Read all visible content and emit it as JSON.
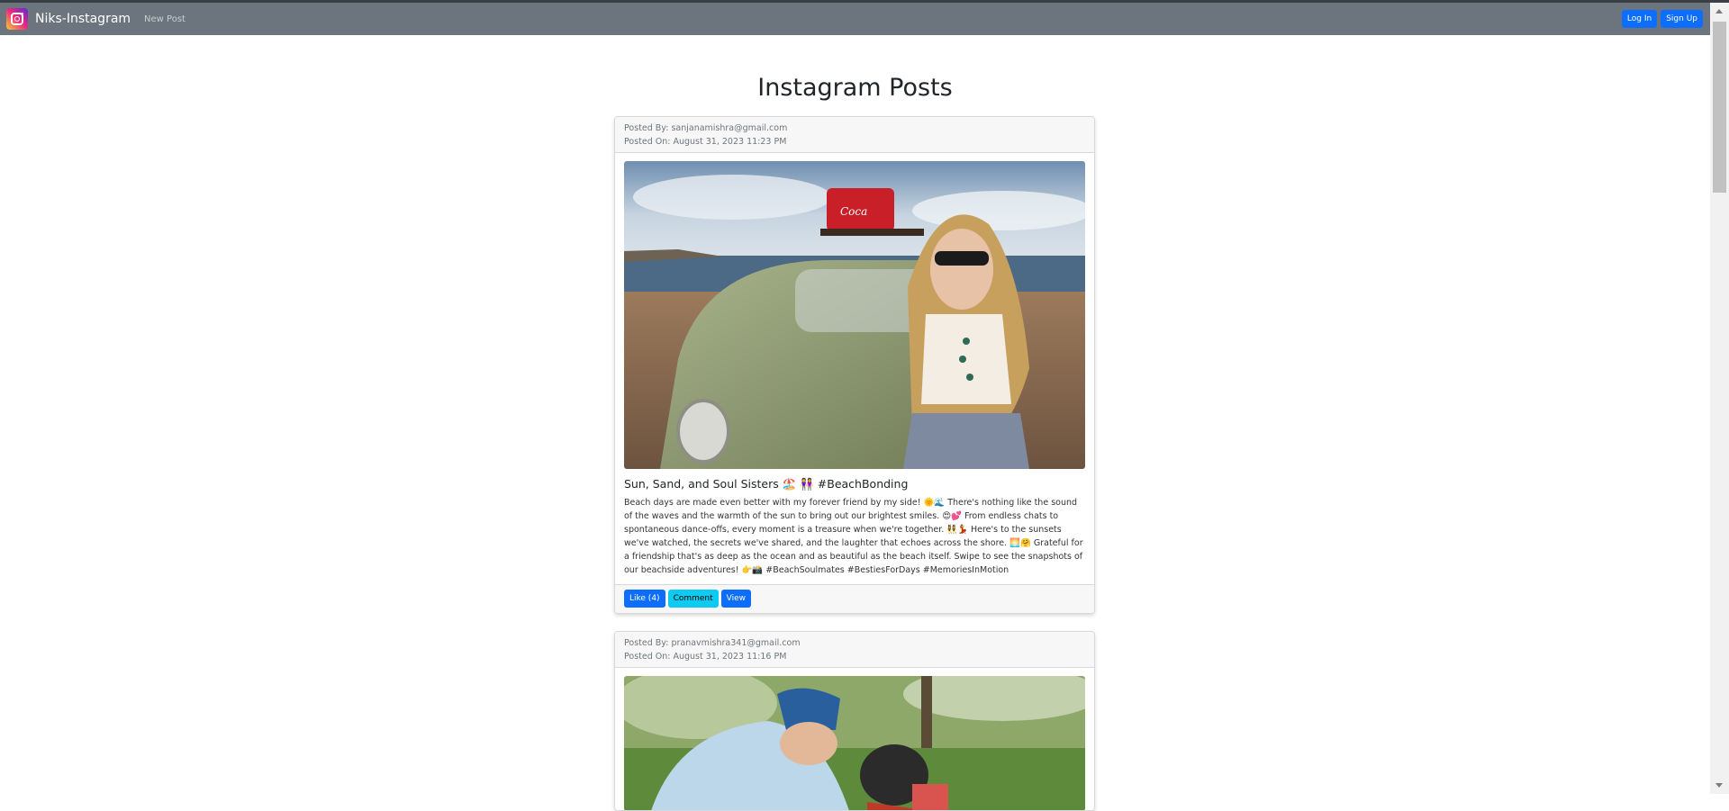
{
  "app": {
    "brand": "Niks-Instagram",
    "nav_new_post": "New Post",
    "login_label": "Log In",
    "signup_label": "Sign Up"
  },
  "page": {
    "title": "Instagram Posts"
  },
  "posts": [
    {
      "posted_by": "Posted By: sanjanamishra@gmail.com",
      "posted_on": "Posted On: August 31, 2023 11:23 PM",
      "title": "Sun, Sand, and Soul Sisters 🏖️ 👭 #BeachBonding",
      "body": "Beach days are made even better with my forever friend by my side! 🌞🌊 There's nothing like the sound of the waves and the warmth of the sun to bring out our brightest smiles. 😍💕 From endless chats to spontaneous dance-offs, every moment is a treasure when we're together. 👯‍♀️💃 Here's to the sunsets we've watched, the secrets we've shared, and the laughter that echoes across the shore. 🌅🤗 Grateful for a friendship that's as deep as the ocean and as beautiful as the beach itself. Swipe to see the snapshots of our beachside adventures! 👉📸 #BeachSoulmates #BestiesForDays #MemoriesInMotion",
      "like_label": "Like (4)",
      "comment_label": "Comment",
      "view_label": "View"
    },
    {
      "posted_by": "Posted By: pranavmishra341@gmail.com",
      "posted_on": "Posted On: August 31, 2023 11:16 PM"
    }
  ],
  "colors": {
    "navbar": "#6c757d",
    "primary": "#0d6efd",
    "info": "#0dcaf0"
  }
}
